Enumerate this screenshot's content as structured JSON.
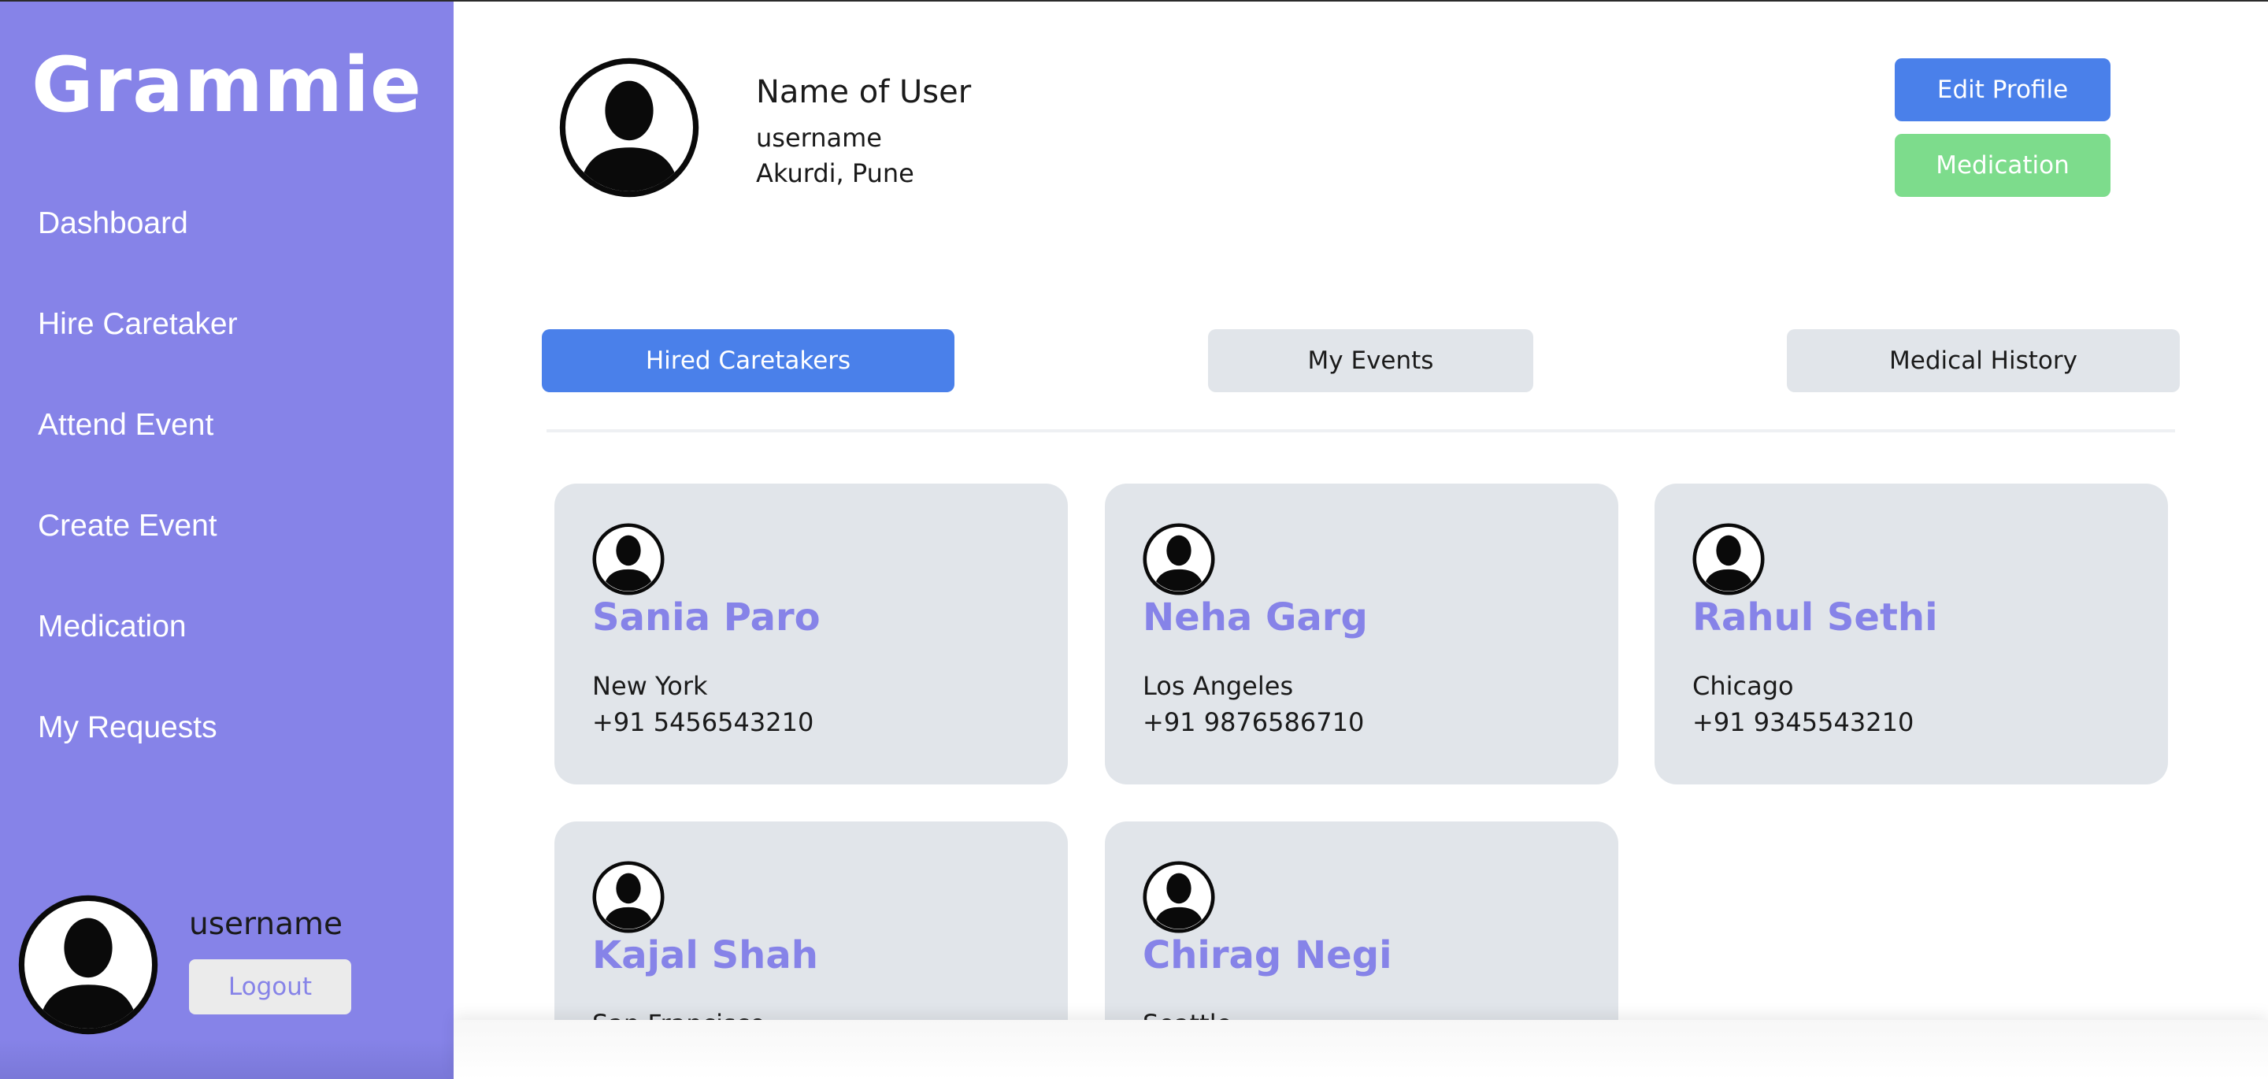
{
  "app": {
    "brand": "Grammie"
  },
  "sidebar": {
    "items": [
      {
        "label": "Dashboard"
      },
      {
        "label": "Hire Caretaker"
      },
      {
        "label": "Attend Event"
      },
      {
        "label": "Create Event"
      },
      {
        "label": "Medication"
      },
      {
        "label": "My Requests"
      }
    ],
    "user": {
      "username": "username",
      "logout_label": "Logout",
      "avatar_icon": "user-avatar-icon"
    }
  },
  "profile": {
    "name": "Name of User",
    "username": "username",
    "location": "Akurdi, Pune",
    "edit_label": "Edit Profile",
    "medication_label": "Medication",
    "avatar_icon": "user-avatar-icon"
  },
  "tabs": [
    {
      "label": "Hired Caretakers",
      "active": true
    },
    {
      "label": "My Events",
      "active": false
    },
    {
      "label": "Medical History",
      "active": false
    }
  ],
  "caretakers": [
    {
      "name": "Sania Paro",
      "city": "New York",
      "phone": "+91 5456543210"
    },
    {
      "name": "Neha Garg",
      "city": "Los Angeles",
      "phone": "+91 9876586710"
    },
    {
      "name": "Rahul Sethi",
      "city": "Chicago",
      "phone": "+91 9345543210"
    },
    {
      "name": "Kajal Shah",
      "city": "San Francisco",
      "phone": ""
    },
    {
      "name": "Chirag Negi",
      "city": "Seattle",
      "phone": ""
    }
  ],
  "colors": {
    "sidebar": "#8683e8",
    "primary": "#4a80ea",
    "success": "#7ddc8c",
    "card": "#e1e5ea",
    "accent_text": "#8683e8"
  }
}
